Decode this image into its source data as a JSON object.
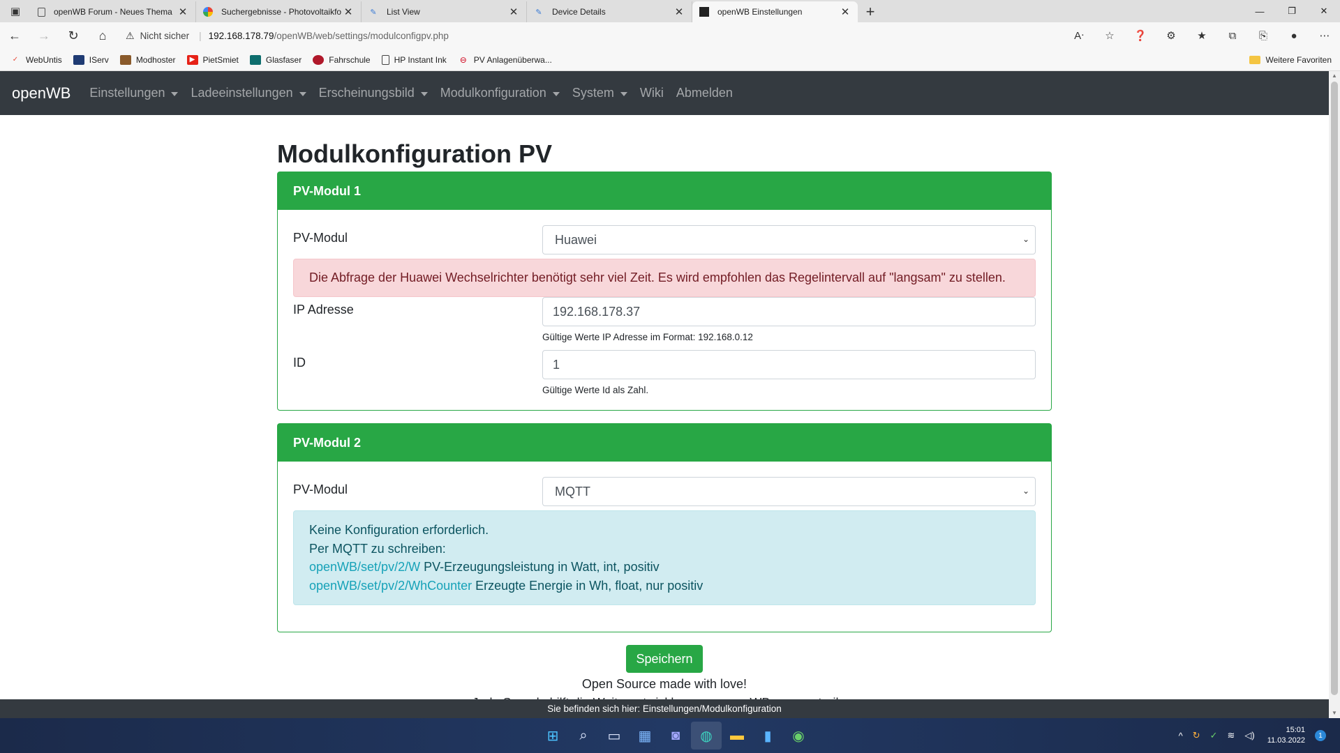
{
  "browser": {
    "tabs": [
      {
        "title": "openWB Forum - Neues Thema",
        "close": "✕"
      },
      {
        "title": "Suchergebnisse - Photovoltaikfo",
        "close": "✕"
      },
      {
        "title": "List View",
        "close": "✕"
      },
      {
        "title": "Device Details",
        "close": "✕"
      },
      {
        "title": "openWB Einstellungen",
        "close": "✕"
      }
    ],
    "new_tab": "+",
    "security_label": "Nicht sicher",
    "url_host": "192.168.178.79",
    "url_path": "/openWB/web/settings/modulconfigpv.php",
    "favorites": [
      "WebUntis",
      "IServ",
      "Modhoster",
      "PietSmiet",
      "Glasfaser",
      "Fahrschule",
      "HP Instant Ink",
      "PV Anlagenüberwa..."
    ],
    "favorites_folder": "Weitere Favoriten"
  },
  "nav": {
    "brand": "openWB",
    "items": [
      "Einstellungen",
      "Ladeeinstellungen",
      "Erscheinungsbild",
      "Modulkonfiguration",
      "System",
      "Wiki",
      "Abmelden"
    ]
  },
  "page": {
    "title": "Modulkonfiguration PV",
    "module1": {
      "header": "PV-Modul 1",
      "module_label": "PV-Modul",
      "module_value": "Huawei",
      "warning": "Die Abfrage der Huawei Wechselrichter benötigt sehr viel Zeit. Es wird empfohlen das Regelintervall auf \"langsam\" zu stellen.",
      "ip_label": "IP Adresse",
      "ip_value": "192.168.178.37",
      "ip_help": "Gültige Werte IP Adresse im Format: 192.168.0.12",
      "id_label": "ID",
      "id_value": "1",
      "id_help": "Gültige Werte Id als Zahl."
    },
    "module2": {
      "header": "PV-Modul 2",
      "module_label": "PV-Modul",
      "module_value": "MQTT",
      "info_line1": "Keine Konfiguration erforderlich.",
      "info_line2": "Per MQTT zu schreiben:",
      "topic1": "openWB/set/pv/2/W",
      "topic1_desc": " PV-Erzeugungsleistung in Watt, int, positiv",
      "topic2": "openWB/set/pv/2/WhCounter",
      "topic2_desc": " Erzeugte Energie in Wh, float, nur positiv"
    },
    "save_button": "Speichern",
    "footer_line1": "Open Source made with love!",
    "footer_line2": "Jede Spende hilft die Weiterentwicklung von openWB voranzutreiben",
    "breadcrumb": "Sie befinden sich hier: Einstellungen/Modulkonfiguration"
  },
  "taskbar": {
    "time": "15:01",
    "date": "11.03.2022",
    "notifications": "1"
  }
}
